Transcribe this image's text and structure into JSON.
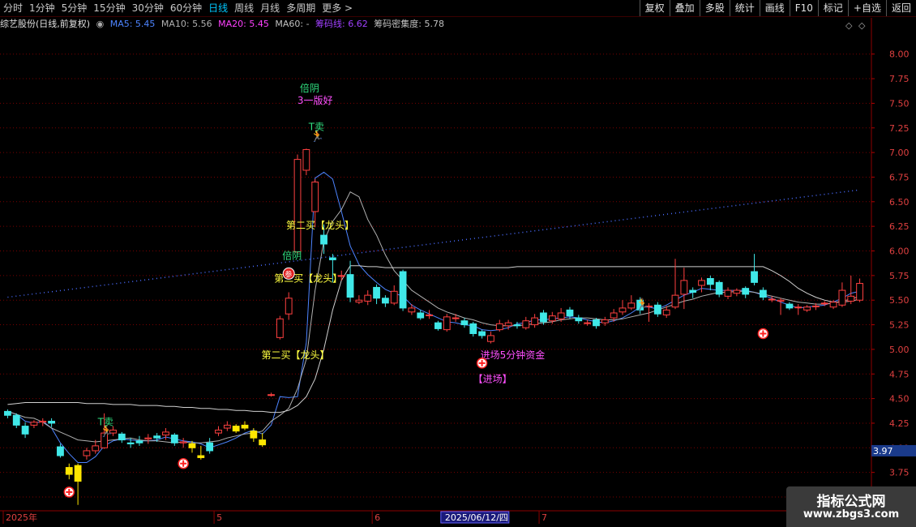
{
  "toolbar": {
    "periods": [
      "分时",
      "1分钟",
      "5分钟",
      "15分钟",
      "30分钟",
      "60分钟",
      "日线",
      "周线",
      "月线",
      "多周期",
      "更多 >"
    ],
    "active_index": 6,
    "right_buttons": [
      "复权",
      "叠加",
      "多股",
      "统计",
      "画线",
      "F10",
      "标记",
      "+自选",
      "返回"
    ]
  },
  "info": {
    "stock": "综艺股份(日线,前复权)",
    "ma5": "MA5: 5.45",
    "ma10": "MA10: 5.56",
    "ma20": "MA20: 5.45",
    "ma60": "MA60: -",
    "chip_line": "筹码线: 6.62",
    "chip_density": "筹码密集度: 5.78",
    "colors": {
      "ma5": "#4d84ff",
      "ma10": "#b0b0b0",
      "ma20": "#ff40ff",
      "ma60": "#c0c0c0",
      "chip": "#a040ff"
    }
  },
  "chart_data": {
    "type": "candlestick",
    "y_ticks": [
      "8.00",
      "7.75",
      "7.50",
      "7.25",
      "7.00",
      "6.75",
      "6.50",
      "6.25",
      "6.00",
      "5.75",
      "5.50",
      "5.25",
      "5.00",
      "4.75",
      "4.50",
      "4.25",
      "4.00",
      "3.75",
      "3.50"
    ],
    "y_range": [
      3.36,
      8.22
    ],
    "current_price": "3.97",
    "x_labels": [
      {
        "text": "2025年",
        "i": 0
      },
      {
        "text": "5",
        "i": 24
      },
      {
        "text": "6",
        "i": 42
      },
      {
        "text": "2025/06/12/四",
        "i": 50,
        "highlight": true
      },
      {
        "text": "7",
        "i": 61
      }
    ],
    "candles": [
      [
        4.37,
        4.33,
        4.39,
        4.3
      ],
      [
        4.33,
        4.23,
        4.35,
        4.2
      ],
      [
        4.22,
        4.14,
        4.26,
        4.1
      ],
      [
        4.23,
        4.26,
        4.28,
        4.2
      ],
      [
        4.26,
        4.27,
        4.3,
        4.22
      ],
      [
        4.27,
        4.25,
        4.3,
        4.21
      ],
      [
        4.01,
        3.92,
        4.04,
        3.9
      ],
      [
        3.8,
        3.73,
        3.84,
        3.68
      ],
      [
        3.82,
        3.66,
        3.84,
        3.42
      ],
      [
        3.92,
        3.97,
        4.0,
        3.88
      ],
      [
        3.97,
        4.02,
        4.08,
        3.94
      ],
      [
        4.0,
        4.15,
        4.35,
        3.99
      ],
      [
        4.15,
        4.18,
        4.22,
        4.12
      ],
      [
        4.14,
        4.08,
        4.16,
        4.05
      ],
      [
        4.05,
        4.04,
        4.1,
        4.0
      ],
      [
        4.07,
        4.05,
        4.12,
        4.02
      ],
      [
        4.09,
        4.1,
        4.14,
        4.04
      ],
      [
        4.12,
        4.1,
        4.15,
        4.06
      ],
      [
        4.13,
        4.16,
        4.2,
        4.08
      ],
      [
        4.13,
        4.05,
        4.15,
        4.02
      ],
      [
        4.05,
        4.06,
        4.1,
        4.0
      ],
      [
        4.04,
        4.0,
        4.07,
        3.95
      ],
      [
        3.92,
        3.9,
        4.02,
        3.88
      ],
      [
        4.05,
        3.97,
        4.1,
        3.94
      ],
      [
        4.15,
        4.18,
        4.22,
        4.12
      ],
      [
        4.2,
        4.23,
        4.27,
        4.17
      ],
      [
        4.22,
        4.17,
        4.24,
        4.15
      ],
      [
        4.23,
        4.2,
        4.27,
        4.18
      ],
      [
        4.17,
        4.1,
        4.2,
        4.06
      ],
      [
        4.08,
        4.03,
        4.15,
        4.01
      ],
      [
        4.54,
        4.54,
        4.56,
        4.52
      ],
      [
        5.12,
        5.31,
        5.34,
        5.1
      ],
      [
        5.36,
        5.52,
        5.58,
        5.3
      ],
      [
        5.99,
        6.93,
        6.98,
        5.98
      ],
      [
        6.82,
        7.03,
        7.04,
        6.77
      ],
      [
        6.4,
        6.7,
        6.73,
        6.24
      ],
      [
        6.16,
        6.07,
        6.27,
        5.97
      ],
      [
        5.93,
        5.91,
        5.97,
        5.68
      ],
      [
        5.75,
        5.75,
        5.8,
        5.7
      ],
      [
        5.76,
        5.53,
        5.9,
        5.48
      ],
      [
        5.48,
        5.5,
        5.55,
        5.46
      ],
      [
        5.49,
        5.55,
        5.6,
        5.45
      ],
      [
        5.63,
        5.52,
        5.66,
        5.46
      ],
      [
        5.52,
        5.47,
        5.55,
        5.43
      ],
      [
        5.47,
        5.59,
        5.65,
        5.45
      ],
      [
        5.79,
        5.42,
        5.81,
        5.39
      ],
      [
        5.38,
        5.42,
        5.46,
        5.35
      ],
      [
        5.37,
        5.32,
        5.4,
        5.3
      ],
      [
        5.35,
        5.35,
        5.4,
        5.31
      ],
      [
        5.27,
        5.21,
        5.29,
        5.19
      ],
      [
        5.2,
        5.33,
        5.36,
        5.18
      ],
      [
        5.32,
        5.32,
        5.36,
        5.28
      ],
      [
        5.29,
        5.25,
        5.32,
        5.22
      ],
      [
        5.26,
        5.16,
        5.28,
        5.13
      ],
      [
        5.18,
        5.14,
        5.2,
        5.11
      ],
      [
        5.08,
        5.14,
        5.18,
        5.06
      ],
      [
        5.2,
        5.26,
        5.3,
        5.18
      ],
      [
        5.24,
        5.27,
        5.3,
        5.2
      ],
      [
        5.25,
        5.24,
        5.28,
        5.21
      ],
      [
        5.22,
        5.29,
        5.33,
        5.2
      ],
      [
        5.25,
        5.32,
        5.36,
        5.22
      ],
      [
        5.37,
        5.28,
        5.4,
        5.25
      ],
      [
        5.29,
        5.34,
        5.38,
        5.26
      ],
      [
        5.31,
        5.37,
        5.42,
        5.28
      ],
      [
        5.4,
        5.34,
        5.43,
        5.31
      ],
      [
        5.32,
        5.29,
        5.35,
        5.26
      ],
      [
        5.27,
        5.27,
        5.3,
        5.24
      ],
      [
        5.3,
        5.24,
        5.32,
        5.21
      ],
      [
        5.27,
        5.3,
        5.33,
        5.24
      ],
      [
        5.32,
        5.37,
        5.41,
        5.28
      ],
      [
        5.38,
        5.42,
        5.5,
        5.35
      ],
      [
        5.42,
        5.47,
        5.55,
        5.4
      ],
      [
        5.5,
        5.4,
        5.53,
        5.36
      ],
      [
        5.44,
        5.44,
        5.47,
        5.28
      ],
      [
        5.45,
        5.36,
        5.48,
        5.33
      ],
      [
        5.35,
        5.4,
        5.44,
        5.32
      ],
      [
        5.43,
        5.55,
        5.92,
        5.41
      ],
      [
        5.56,
        5.7,
        5.83,
        5.41
      ],
      [
        5.6,
        5.58,
        5.63,
        5.52
      ],
      [
        5.65,
        5.7,
        5.73,
        5.58
      ],
      [
        5.72,
        5.66,
        5.75,
        5.6
      ],
      [
        5.68,
        5.56,
        5.7,
        5.53
      ],
      [
        5.54,
        5.6,
        5.63,
        5.51
      ],
      [
        5.57,
        5.6,
        5.62,
        5.54
      ],
      [
        5.62,
        5.56,
        5.64,
        5.52
      ],
      [
        5.79,
        5.68,
        5.97,
        5.65
      ],
      [
        5.6,
        5.53,
        5.63,
        5.5
      ],
      [
        5.51,
        5.51,
        5.54,
        5.48
      ],
      [
        5.49,
        5.5,
        5.52,
        5.35
      ],
      [
        5.46,
        5.42,
        5.48,
        5.4
      ],
      [
        5.43,
        5.43,
        5.46,
        5.35
      ],
      [
        5.4,
        5.43,
        5.45,
        5.38
      ],
      [
        5.44,
        5.44,
        5.47,
        5.4
      ],
      [
        5.47,
        5.47,
        5.49,
        5.44
      ],
      [
        5.43,
        5.48,
        5.5,
        5.41
      ],
      [
        5.45,
        5.6,
        5.68,
        5.43
      ],
      [
        5.49,
        5.54,
        5.75,
        5.46
      ],
      [
        5.5,
        5.67,
        5.72,
        5.48
      ]
    ],
    "yellow_candles": [
      7,
      8,
      21,
      22,
      26,
      27,
      28,
      29
    ],
    "series": [
      {
        "name": "MA5",
        "color": "#4d84ff",
        "y": [
          4.37,
          4.34,
          4.27,
          4.25,
          4.27,
          4.2,
          4.05,
          3.94,
          3.85,
          3.85,
          3.91,
          4.02,
          4.07,
          4.09,
          4.08,
          4.07,
          4.07,
          4.08,
          4.11,
          4.09,
          4.07,
          4.06,
          4.04,
          4.0,
          4.03,
          4.06,
          4.1,
          4.15,
          4.18,
          4.14,
          4.23,
          4.52,
          4.51,
          4.52,
          5.07,
          6.74,
          6.8,
          6.73,
          6.4,
          6.05,
          5.86,
          5.76,
          5.68,
          5.61,
          5.57,
          5.54,
          5.45,
          5.4,
          5.36,
          5.32,
          5.28,
          5.27,
          5.25,
          5.24,
          5.2,
          5.19,
          5.2,
          5.22,
          5.26,
          5.27,
          5.3,
          5.3,
          5.31,
          5.32,
          5.33,
          5.32,
          5.3,
          5.28,
          5.27,
          5.29,
          5.32,
          5.37,
          5.43,
          5.43,
          5.41,
          5.45,
          5.5,
          5.55,
          5.58,
          5.62,
          5.61,
          5.6,
          5.6,
          5.6,
          5.6,
          5.58,
          5.55,
          5.52,
          5.48,
          5.45,
          5.42,
          5.43,
          5.44,
          5.45,
          5.48,
          5.52,
          5.57,
          5.59
        ]
      },
      {
        "name": "MA10",
        "color": "#b0b0b0",
        "y": [
          4.37,
          4.34,
          4.31,
          4.3,
          4.26,
          4.2,
          4.16,
          4.12,
          4.08,
          4.07,
          4.06,
          4.07,
          4.08,
          4.09,
          4.1,
          4.08,
          4.07,
          4.07,
          4.06,
          4.05,
          4.06,
          4.05,
          4.05,
          4.06,
          4.07,
          4.1,
          4.12,
          4.14,
          4.15,
          4.17,
          4.27,
          4.33,
          4.4,
          4.6,
          4.9,
          5.6,
          6.1,
          6.3,
          6.42,
          6.6,
          6.55,
          6.32,
          6.16,
          5.96,
          5.8,
          5.7,
          5.6,
          5.54,
          5.48,
          5.42,
          5.38,
          5.35,
          5.32,
          5.3,
          5.27,
          5.25,
          5.24,
          5.24,
          5.24,
          5.25,
          5.26,
          5.27,
          5.28,
          5.3,
          5.31,
          5.32,
          5.32,
          5.31,
          5.3,
          5.3,
          5.31,
          5.33,
          5.35,
          5.37,
          5.4,
          5.43,
          5.46,
          5.49,
          5.51,
          5.54,
          5.56,
          5.58,
          5.58,
          5.59,
          5.59,
          5.58,
          5.56,
          5.54,
          5.52,
          5.5,
          5.48,
          5.47,
          5.46,
          5.46,
          5.47,
          5.49,
          5.51,
          5.54
        ]
      },
      {
        "name": "MA60",
        "color": "#d0d0d0",
        "y": [
          4.44,
          4.45,
          4.46,
          4.46,
          4.46,
          4.46,
          4.46,
          4.46,
          4.46,
          4.45,
          4.45,
          4.45,
          4.44,
          4.44,
          4.44,
          4.43,
          4.43,
          4.43,
          4.42,
          4.42,
          4.41,
          4.41,
          4.4,
          4.4,
          4.39,
          4.39,
          4.38,
          4.38,
          4.37,
          4.37,
          4.36,
          4.36,
          4.38,
          4.43,
          4.52,
          4.7,
          5.0,
          5.4,
          5.7,
          5.85,
          5.85,
          5.84,
          5.84,
          5.83,
          5.83,
          5.83,
          5.83,
          5.83,
          5.83,
          5.83,
          5.83,
          5.83,
          5.83,
          5.83,
          5.83,
          5.83,
          5.83,
          5.83,
          5.84,
          5.84,
          5.84,
          5.84,
          5.84,
          5.84,
          5.84,
          5.84,
          5.84,
          5.84,
          5.84,
          5.84,
          5.84,
          5.84,
          5.84,
          5.84,
          5.84,
          5.84,
          5.84,
          5.84,
          5.84,
          5.84,
          5.84,
          5.84,
          5.84,
          5.84,
          5.84,
          5.84,
          5.84,
          5.8,
          5.75,
          5.69,
          5.62,
          5.57,
          5.53,
          5.5,
          5.48,
          5.48,
          5.49,
          5.51
        ]
      },
      {
        "name": "筹码线",
        "color": "#4a6cff",
        "dotted": true,
        "from": [
          0,
          5.53
        ],
        "to": [
          97,
          6.62
        ]
      }
    ],
    "annotations": [
      {
        "i": 11,
        "v": 4.26,
        "text": "T卖",
        "color": "#30e080",
        "icon": "runner"
      },
      {
        "i": 32,
        "v": 5.95,
        "text": "倍阴",
        "color": "#30e080"
      },
      {
        "i": 32,
        "v": 5.72,
        "text": "第二买【龙头】",
        "color": "#ffff40",
        "dx": -10
      },
      {
        "i": 30,
        "v": 4.94,
        "text": "第二买【龙头】",
        "color": "#ffff40",
        "dx": -4
      },
      {
        "i": 33,
        "v": 6.26,
        "text": "第二买【龙头】",
        "color": "#ffff40",
        "dx": -6
      },
      {
        "i": 34,
        "v": 7.65,
        "text": "倍阴",
        "color": "#30e080"
      },
      {
        "i": 34,
        "v": 7.53,
        "text": "3一版好",
        "color": "#ff50ff",
        "dx": -3
      },
      {
        "i": 35,
        "v": 7.26,
        "text": "T卖",
        "color": "#30e080",
        "icon": "runner"
      },
      {
        "i": 54,
        "v": 4.94,
        "text": "进场5分钟资金",
        "color": "#ff50ff",
        "dx": 6
      },
      {
        "i": 54,
        "v": 4.7,
        "text": "【进场】",
        "color": "#ff50ff",
        "dx": -3
      },
      {
        "i": 72,
        "v": 5.55,
        "text": "",
        "icon": "runner"
      }
    ],
    "entry_markers": [
      {
        "i": 7,
        "v": 3.55
      },
      {
        "i": 20,
        "v": 3.84
      },
      {
        "i": 54,
        "v": 4.86
      },
      {
        "i": 86,
        "v": 5.16
      }
    ],
    "special_markers": [
      {
        "i": 32,
        "v": 5.77,
        "icon": "参"
      }
    ]
  },
  "watermark": {
    "line1": "指标公式网",
    "line2": "www.zbgs3.com"
  }
}
